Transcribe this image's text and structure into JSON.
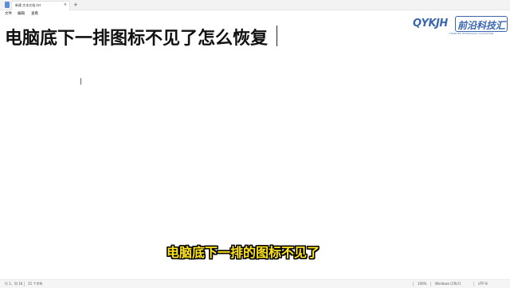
{
  "window": {
    "tab_title": "新建 文本文档.txt",
    "tab_close": "×",
    "new_tab": "+"
  },
  "menu": {
    "items": [
      "文件",
      "编辑",
      "查看"
    ]
  },
  "document": {
    "text": "电脑底下一排图标不见了怎么恢复"
  },
  "logo": {
    "mark": "QYKJH",
    "name": "前沿科技汇",
    "tagline": "FRONTIER TECHNOLOGY COLLECTION"
  },
  "subtitle": "电脑底下一排的图标不见了",
  "statusbar": {
    "position": "行 1，列 16",
    "chars": "15 个字符",
    "zoom": "100%",
    "line_ending": "Windows (CRLF)",
    "encoding": "UTF-8"
  },
  "colors": {
    "logo_blue": "#3a67b0",
    "subtitle_yellow": "#ffe41a"
  }
}
